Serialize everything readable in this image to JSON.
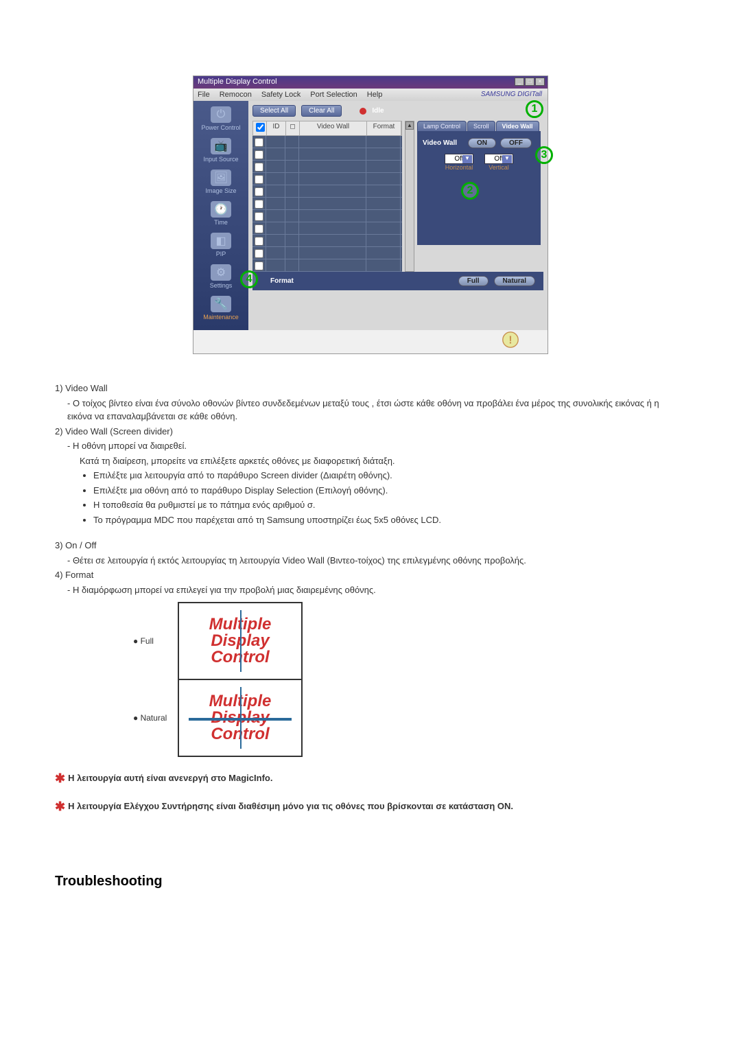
{
  "window": {
    "title": "Multiple Display Control",
    "minimize": "_",
    "maximize": "□",
    "close": "×"
  },
  "menu": {
    "file": "File",
    "remocon": "Remocon",
    "safety_lock": "Safety Lock",
    "port_selection": "Port Selection",
    "help": "Help",
    "brand": "SAMSUNG DIGITall"
  },
  "sidebar": {
    "items": [
      {
        "label": "Power Control"
      },
      {
        "label": "Input Source"
      },
      {
        "label": "Image Size"
      },
      {
        "label": "Time"
      },
      {
        "label": "PIP"
      },
      {
        "label": "Settings"
      },
      {
        "label": "Maintenance"
      }
    ]
  },
  "toolbar": {
    "select_all": "Select All",
    "clear_all": "Clear All",
    "idle": "Idle"
  },
  "grid": {
    "headers": {
      "id": "ID",
      "video_wall": "Video Wall",
      "format": "Format"
    }
  },
  "tabs": {
    "lamp": "Lamp Control",
    "scroll": "Scroll",
    "video_wall": "Video Wall"
  },
  "panel": {
    "video_wall_label": "Video Wall",
    "on": "ON",
    "off": "OFF",
    "horizontal_value": "Off",
    "vertical_value": "Off",
    "horizontal": "Horizontal",
    "vertical": "Vertical"
  },
  "bottom": {
    "format": "Format",
    "full": "Full",
    "natural": "Natural"
  },
  "list": {
    "h1": "1)  Video Wall",
    "h1_sub": "- Ο τοίχος βίντεο είναι ένα σύνολο οθονών βίντεο συνδεδεμένων μεταξύ τους , έτσι ώστε κάθε οθόνη να προβάλει ένα μέρος της συνολικής εικόνας ή η εικόνα να επαναλαμβάνεται σε κάθε οθόνη.",
    "h2": "2)  Video Wall (Screen divider)",
    "h2_sub1": "- Η οθόνη μπορεί να διαιρεθεί.",
    "h2_sub2": "Κατά τη διαίρεση, μπορείτε να επιλέξετε αρκετές οθόνες με διαφορετική διάταξη.",
    "h2_li1": "Επιλέξτε μια λειτουργία από το παράθυρο Screen divider (Διαιρέτη οθόνης).",
    "h2_li2": "Επιλέξτε μια οθόνη από το παράθυρο Display Selection (Επιλογή οθόνης).",
    "h2_li3": "Η τοποθεσία θα ρυθμιστεί με το πάτημα ενός αριθμού σ.",
    "h2_li4": "Το πρόγραμμα MDC που παρέχεται από τη Samsung υποστηρίζει έως 5x5 οθόνες LCD.",
    "h3": "3)  On / Off",
    "h3_sub": "- Θέτει σε λειτουργία ή εκτός λειτουργίας τη λειτουργία Video Wall (Βιντεο-τοίχος) της επιλεγμένης οθόνης προβολής.",
    "h4": "4)  Format",
    "h4_sub": "- Η διαμόρφωση μπορεί να επιλεγεί για την προβολή μιας διαιρεμένης οθόνης.",
    "full": "Full",
    "natural": "Natural",
    "mdc1": "Multiple",
    "mdc2": "Display",
    "mdc3": "Control"
  },
  "notes": {
    "n1": "Η λειτουργία αυτή είναι ανενεργή στο MagicInfo.",
    "n2": "Η λειτουργία Ελέγχου Συντήρησης είναι διαθέσιμη μόνο για τις οθόνες που βρίσκονται σε κατάσταση ON."
  },
  "troubleshooting": "Troubleshooting",
  "callouts": {
    "c1": "1",
    "c2": "2",
    "c3": "3",
    "c4": "4"
  }
}
